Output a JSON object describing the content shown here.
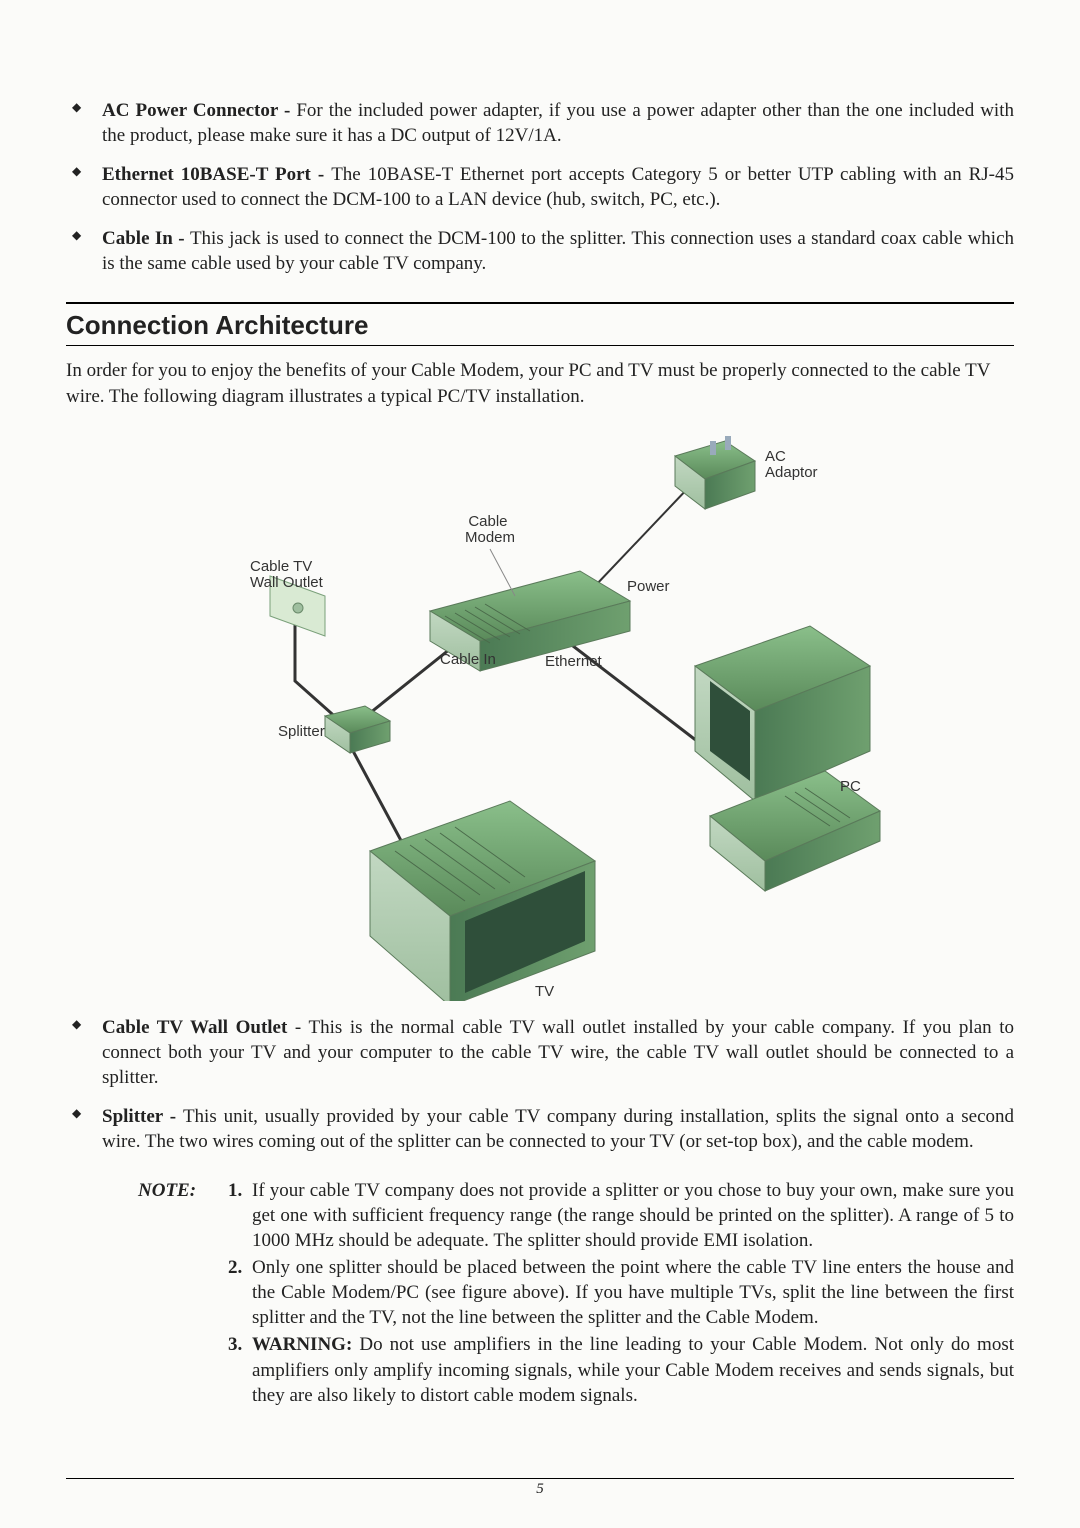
{
  "top_bullets": [
    {
      "term": "AC Power Connector - ",
      "text": "For the included power adapter, if you use a power adapter other than the one included with the product, please make sure it has a DC output of 12V/1A."
    },
    {
      "term": "Ethernet 10BASE-T Port - ",
      "text": "The 10BASE-T Ethernet port accepts Category 5 or better UTP cabling with an RJ-45 connector used to connect the DCM-100 to a LAN device (hub, switch, PC, etc.)."
    },
    {
      "term": "Cable In - ",
      "text": "This jack is used to connect the DCM-100 to the splitter. This connection uses a standard coax cable which is the same cable used by your cable TV company."
    }
  ],
  "section_title": "Connection Architecture",
  "intro": "In order for you to enjoy the benefits of your Cable Modem, your PC and TV must be properly connected to the cable TV wire. The following diagram illustrates a typical PC/TV installation.",
  "diagram_labels": {
    "ac": "AC\nAdaptor",
    "modem": "Cable\nModem",
    "power": "Power",
    "wall": "Cable TV\nWall Outlet",
    "cablein": "Cable In",
    "ethernet": "Ethernet",
    "splitter": "Splitter",
    "pc": "PC",
    "tv": "TV"
  },
  "lower_bullets": [
    {
      "term": "Cable TV Wall Outlet",
      "sep": " - ",
      "text": "This is the normal cable TV wall outlet installed by your cable company. If you plan to connect both your TV and your computer to the cable TV wire, the cable TV wall outlet should be connected to a splitter."
    },
    {
      "term": "Splitter - ",
      "sep": "",
      "text": "This unit, usually provided by your cable TV company during installation, splits the signal onto a second wire. The two wires coming out of the splitter can be connected to your TV (or set-top box), and the cable modem."
    }
  ],
  "note": {
    "label": "NOTE:",
    "items": [
      {
        "n": "1.",
        "text": "If your cable TV company does not provide a splitter or you chose to buy your own, make sure you get one with sufficient frequency range (the range should be printed on the splitter). A range of 5 to 1000 MHz should be adequate. The splitter should provide EMI isolation."
      },
      {
        "n": "2.",
        "text": "Only one splitter should be placed between the point where the cable TV line enters the house and the Cable Modem/PC (see figure above). If you have multiple TVs, split the line between the first splitter and the TV, not the line between the splitter and the Cable Modem."
      },
      {
        "n": "3.",
        "lead": "WARNING: ",
        "text": "Do not use amplifiers in the line leading to your Cable Modem. Not only do most amplifiers only amplify incoming signals, while your Cable Modem receives and sends signals, but they are also likely to distort cable modem signals."
      }
    ]
  },
  "page_number": "5"
}
